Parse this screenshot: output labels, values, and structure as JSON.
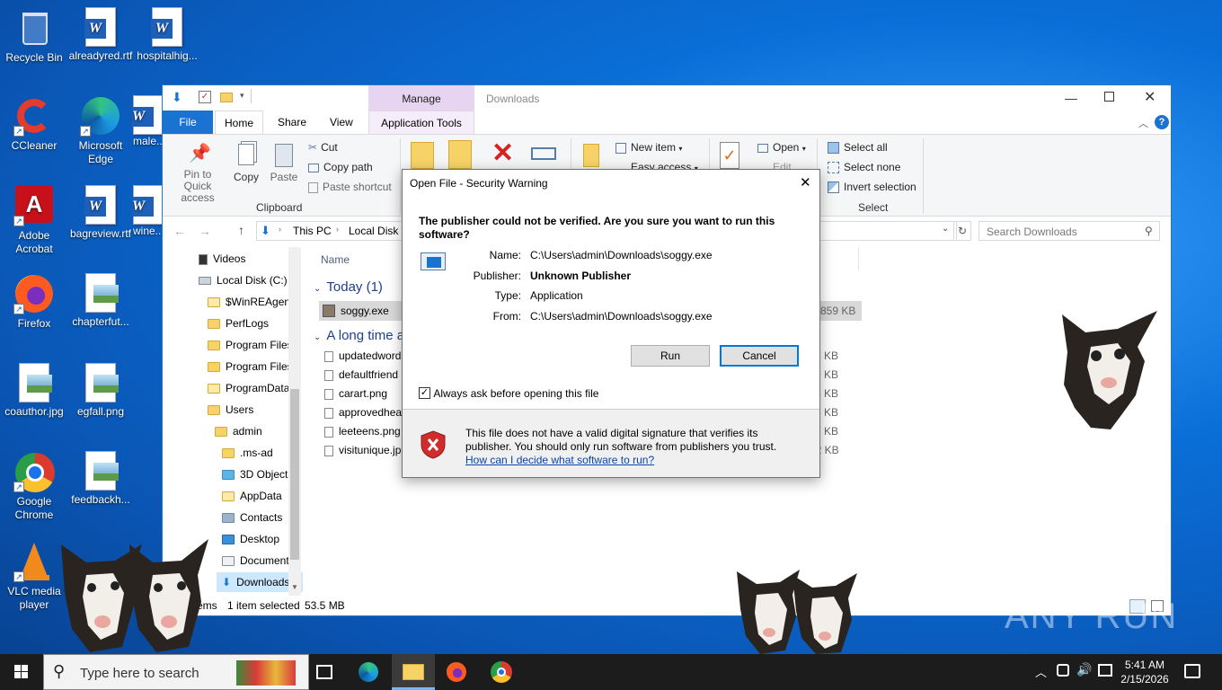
{
  "desktop": {
    "icons": [
      {
        "label": "Recycle Bin",
        "icon": "recycle-bin-icon"
      },
      {
        "label": "alreadyred.rtf",
        "icon": "word-doc-icon"
      },
      {
        "label": "hospitalhig...",
        "icon": "word-doc-icon"
      },
      {
        "label": "CCleaner",
        "icon": "ccleaner-icon"
      },
      {
        "label": "Microsoft Edge",
        "icon": "edge-icon"
      },
      {
        "label": "male...",
        "icon": "word-doc-icon"
      },
      {
        "label": "Adobe Acrobat",
        "icon": "acrobat-icon"
      },
      {
        "label": "bagreview.rtf",
        "icon": "word-doc-icon"
      },
      {
        "label": "wine...",
        "icon": "word-doc-icon"
      },
      {
        "label": "Firefox",
        "icon": "firefox-icon"
      },
      {
        "label": "chapterfut...",
        "icon": "image-file-icon"
      },
      {
        "label": "coauthor.jpg",
        "icon": "image-file-icon"
      },
      {
        "label": "egfall.png",
        "icon": "image-file-icon"
      },
      {
        "label": "Google Chrome",
        "icon": "chrome-icon"
      },
      {
        "label": "feedbackh...",
        "icon": "image-file-icon"
      },
      {
        "label": "VLC media player",
        "icon": "vlc-icon"
      }
    ]
  },
  "explorer": {
    "title": "Downloads",
    "contextual_tab_group": "Manage",
    "tabs": [
      "File",
      "Home",
      "Share",
      "View",
      "Application Tools"
    ],
    "clipboard": {
      "pin": "Pin to Quick access",
      "copy": "Copy",
      "paste": "Paste",
      "cut": "Cut",
      "copy_path": "Copy path",
      "paste_shortcut": "Paste shortcut",
      "group": "Clipboard"
    },
    "new_group": {
      "new_item": "New item",
      "easy_access": "Easy access"
    },
    "open_group": {
      "open": "Open",
      "edit": "Edit"
    },
    "select_group": {
      "select_all": "Select all",
      "select_none": "Select none",
      "invert": "Invert selection",
      "group": "Select"
    },
    "address": {
      "crumbs": [
        "This PC",
        "Local Disk ("
      ]
    },
    "search_placeholder": "Search Downloads",
    "nav_tree": [
      "Videos",
      "Local Disk (C:)",
      "$WinREAgent",
      "PerfLogs",
      "Program Files",
      "Program Files",
      "ProgramData",
      "Users",
      "admin",
      ".ms-ad",
      "3D Objects",
      "AppData",
      "Contacts",
      "Desktop",
      "Documents",
      "Downloads"
    ],
    "column_name": "Name",
    "groups": [
      {
        "header": "Today (1)",
        "files": [
          {
            "name": "soggy.exe",
            "size": "859 KB"
          }
        ]
      },
      {
        "header": "A long time a",
        "files": [
          {
            "name": "updatedword",
            "size": "6 KB"
          },
          {
            "name": "defaultfriend",
            "size": "9 KB"
          },
          {
            "name": "carart.png",
            "size": "8 KB"
          },
          {
            "name": "approvedhea",
            "size": "6 KB"
          },
          {
            "name": "leeteens.png",
            "size": "7 KB"
          },
          {
            "name": "visitunique.jp",
            "size": "12 KB"
          }
        ]
      }
    ],
    "status": {
      "items": "7 items",
      "selected": "1 item selected",
      "size": "53.5 MB"
    }
  },
  "dialog": {
    "title": "Open File - Security Warning",
    "heading": "The publisher could not be verified.  Are you sure you want to run this software?",
    "fields": [
      {
        "label": "Name:",
        "value": "C:\\Users\\admin\\Downloads\\soggy.exe"
      },
      {
        "label": "Publisher:",
        "value": "Unknown Publisher"
      },
      {
        "label": "Type:",
        "value": "Application"
      },
      {
        "label": "From:",
        "value": "C:\\Users\\admin\\Downloads\\soggy.exe"
      }
    ],
    "run_label": "Run",
    "cancel_label": "Cancel",
    "checkbox_label": "Always ask before opening this file",
    "checkbox_checked": true,
    "warning_text": "This file does not have a valid digital signature that verifies its publisher.  You should only run software from publishers you trust.",
    "help_link": "How can I decide what software to run?"
  },
  "taskbar": {
    "search_placeholder": "Type here to search",
    "time": "5:41 AM",
    "date": "2/15/2026"
  },
  "watermark": "ANY RUN",
  "colors": {
    "accent": "#1a73d0",
    "manage_tab": "#e7d4f0",
    "selection": "#cce8ff"
  }
}
